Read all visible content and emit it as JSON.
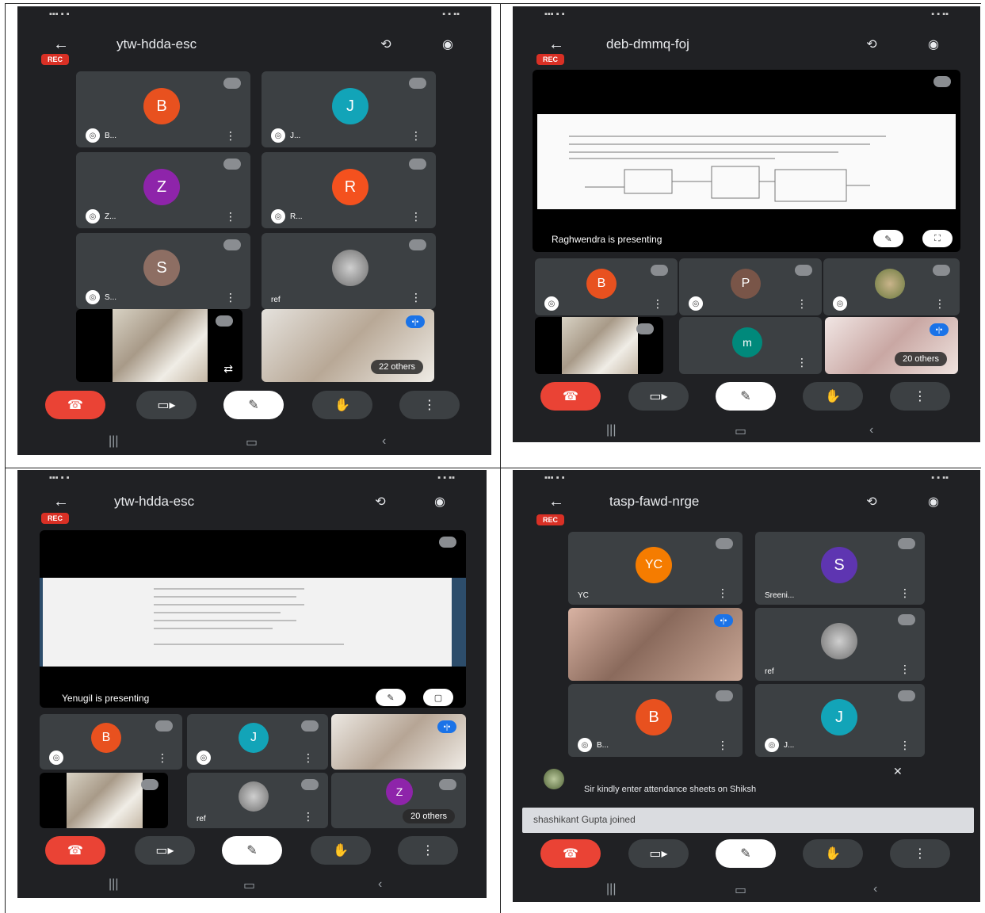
{
  "screens": [
    {
      "meeting_code": "ytw-hdda-esc",
      "rec_label": "REC",
      "tiles": [
        {
          "initial": "B",
          "name": "B...",
          "color": "#e8511f"
        },
        {
          "initial": "J",
          "name": "J...",
          "color": "#12a4b8"
        },
        {
          "initial": "Z",
          "name": "Z...",
          "color": "#8e24aa"
        },
        {
          "initial": "R",
          "name": "R...",
          "color": "#f4511e"
        },
        {
          "initial": "S",
          "name": "S...",
          "color": "#8d6e63"
        },
        {
          "initial": "",
          "name": "ref",
          "color": "#5f6368"
        }
      ],
      "others_label": "22 others"
    },
    {
      "meeting_code": "deb-dmmq-foj",
      "rec_label": "REC",
      "presenting_label": "Raghwendra is presenting",
      "tiles": [
        {
          "initial": "B",
          "color": "#e8511f"
        },
        {
          "initial": "P",
          "color": "#795548"
        },
        {
          "initial": "m",
          "color": "#00897b"
        }
      ],
      "others_label": "20 others"
    },
    {
      "meeting_code": "ytw-hdda-esc",
      "rec_label": "REC",
      "presenting_label": "Yenugil is presenting",
      "tiles": [
        {
          "initial": "B",
          "color": "#e8511f"
        },
        {
          "initial": "J",
          "color": "#12a4b8"
        },
        {
          "initial": "Z",
          "color": "#8e24aa"
        }
      ],
      "ref_label": "ref",
      "others_label": "20 others"
    },
    {
      "meeting_code": "tasp-fawd-nrge",
      "rec_label": "REC",
      "tiles": [
        {
          "initial": "YC",
          "name": "YC",
          "color": "#f57c00"
        },
        {
          "initial": "S",
          "name": "Sreeni...",
          "color": "#5e35b1"
        },
        {
          "initial": "B",
          "name": "B...",
          "color": "#e8511f"
        },
        {
          "initial": "J",
          "name": "J...",
          "color": "#12a4b8"
        }
      ],
      "ref_label": "ref",
      "chat_message": "Sir kindly enter attendance sheets on Shiksh",
      "chat_input": "shashikant Gupta joined"
    }
  ],
  "colors": {
    "end_call": "#ea4335",
    "rec": "#d93025",
    "background": "#202124",
    "tile": "#3c4043"
  }
}
